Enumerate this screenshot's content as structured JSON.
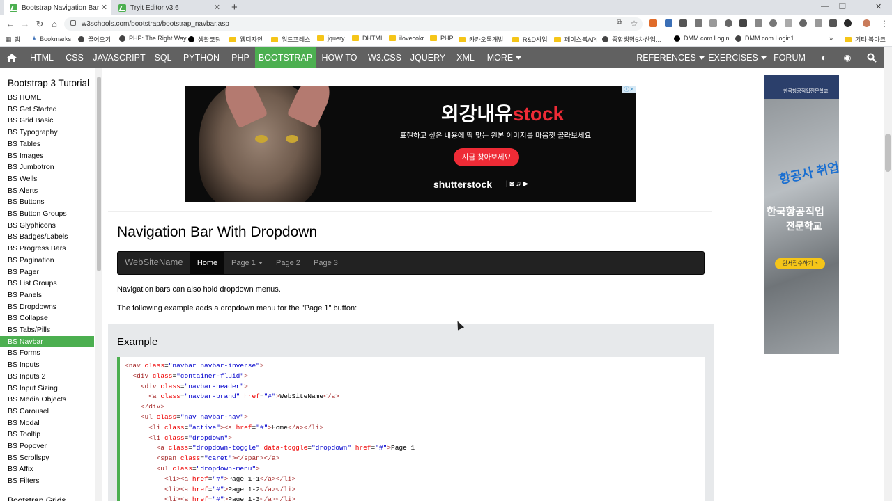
{
  "browser": {
    "tabs": [
      {
        "title": "Bootstrap Navigation Bar"
      },
      {
        "title": "Tryit Editor v3.6"
      }
    ],
    "url": "w3schools.com/bootstrap/bootstrap_navbar.asp",
    "bookmarks": [
      "Bookmarks",
      "끌어오기",
      "PHP: The Right Way",
      "생활코딩",
      "웹디자인",
      "워드프레스",
      "jquery",
      "DHTML",
      "ilovecokr",
      "PHP",
      "카카오톡개발",
      "R&D사업",
      "페이스북API",
      "종합생명6차산업...",
      "DMM.com Login",
      "DMM.com Login1",
      "기타 북마크"
    ],
    "apps_label": "앱"
  },
  "topnav": {
    "items": [
      "HTML",
      "CSS",
      "JAVASCRIPT",
      "SQL",
      "PYTHON",
      "PHP",
      "BOOTSTRAP",
      "HOW TO",
      "W3.CSS",
      "JQUERY",
      "XML",
      "MORE"
    ],
    "active": "BOOTSTRAP",
    "right": [
      "REFERENCES",
      "EXERCISES",
      "FORUM"
    ]
  },
  "sidebar": {
    "title": "Bootstrap 3 Tutorial",
    "items": [
      "BS HOME",
      "BS Get Started",
      "BS Grid Basic",
      "BS Typography",
      "BS Tables",
      "BS Images",
      "BS Jumbotron",
      "BS Wells",
      "BS Alerts",
      "BS Buttons",
      "BS Button Groups",
      "BS Glyphicons",
      "BS Badges/Labels",
      "BS Progress Bars",
      "BS Pagination",
      "BS Pager",
      "BS List Groups",
      "BS Panels",
      "BS Dropdowns",
      "BS Collapse",
      "BS Tabs/Pills",
      "BS Navbar",
      "BS Forms",
      "BS Inputs",
      "BS Inputs 2",
      "BS Input Sizing",
      "BS Media Objects",
      "BS Carousel",
      "BS Modal",
      "BS Tooltip",
      "BS Popover",
      "BS Scrollspy",
      "BS Affix",
      "BS Filters"
    ],
    "active": "BS Navbar",
    "next_heading": "Bootstrap Grids"
  },
  "ad_main": {
    "title_a": "외강내유",
    "title_b": "stock",
    "subtitle": "표현하고 싶은 내용에 딱 맞는 원본 이미지를 마음껏 골라보세요",
    "button": "지금 찾아보세요",
    "brand": "shutterstock",
    "icons": "|  ◙  ♫  ▶"
  },
  "main": {
    "heading": "Navigation Bar With Dropdown",
    "demo": {
      "brand": "WebSiteName",
      "home": "Home",
      "page1": "Page 1",
      "page2": "Page 2",
      "page3": "Page 3"
    },
    "para1": "Navigation bars can also hold dropdown menus.",
    "para2": "The following example adds a dropdown menu for the \"Page 1\" button:",
    "example_title": "Example"
  },
  "code_lines": [
    "<nav class=\"navbar navbar-inverse\">",
    "  <div class=\"container-fluid\">",
    "    <div class=\"navbar-header\">",
    "      <a class=\"navbar-brand\" href=\"#\">WebSiteName</a>",
    "    </div>",
    "    <ul class=\"nav navbar-nav\">",
    "      <li class=\"active\"><a href=\"#\">Home</a></li>",
    "      <li class=\"dropdown\">",
    "        <a class=\"dropdown-toggle\" data-toggle=\"dropdown\" href=\"#\">Page 1",
    "        <span class=\"caret\"></span></a>",
    "        <ul class=\"dropdown-menu\">",
    "          <li><a href=\"#\">Page 1-1</a></li>",
    "          <li><a href=\"#\">Page 1-2</a></li>",
    "          <li><a href=\"#\">Page 1-3</a></li>"
  ],
  "ad_side": {
    "org": "한국항공직업전문학교",
    "line1": "항공사 취업",
    "line2": "한국항공직업",
    "line3": "전문학교",
    "button": "원서접수하기 >"
  },
  "colors": {
    "accent": "#4caf50",
    "topnav": "#616161",
    "demo_nav": "#222222"
  }
}
